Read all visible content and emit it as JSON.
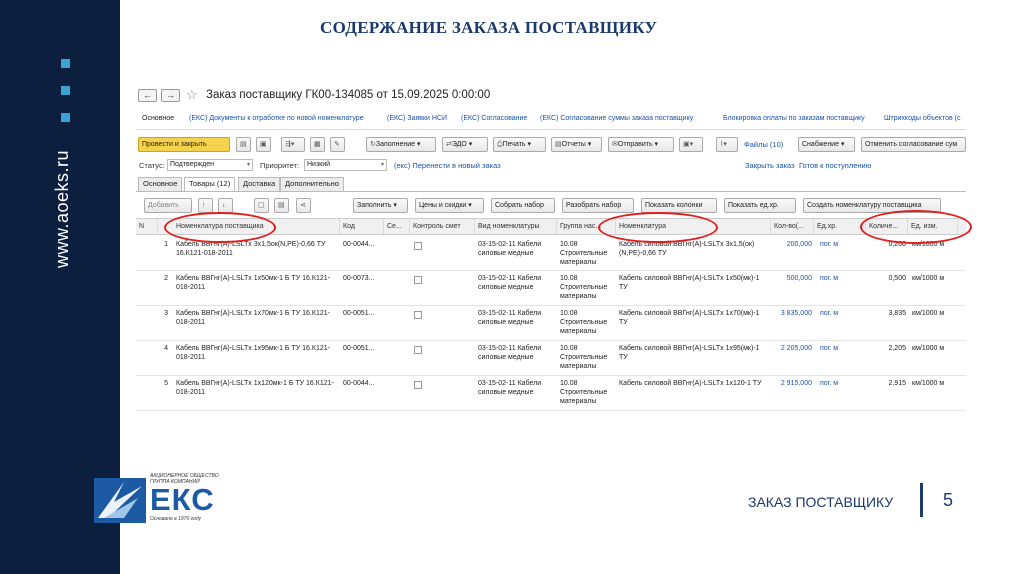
{
  "slide": {
    "title": "СОДЕРЖАНИЕ ЗАКАЗА ПОСТАВЩИКУ",
    "website": "www.aoeks.ru",
    "footer_text": "ЗАКАЗ ПОСТАВЩИКУ",
    "page_number": "5",
    "logo": {
      "top_text": "Акционерное общество\nГРУППА КОМПАНИЙ",
      "name": "ЕКС",
      "sub_text": "Основано в 1970 году"
    },
    "colors": {
      "sidebar": "#0d1f3f",
      "accent": "#3aa3d8",
      "title": "#1b3a6b",
      "highlight": "#e02020"
    }
  },
  "window": {
    "back_icon": "arrow-left-icon",
    "forward_icon": "arrow-right-icon",
    "favorite_icon": "star-icon",
    "document_title": "Заказ поставщику ГК00-134085 от 15.09.2025 0:00:00",
    "nav_links": [
      "Основное",
      "(ЕКС) Документы к отработке по новой номенклатуре",
      "(ЕКС) Заявки НСИ",
      "(ЕКС) Согласование",
      "(ЕКС) Согласование суммы заказа поставщику",
      "Блокировка оплаты по заказам поставщику",
      "Штрихкоды объектов (с"
    ],
    "toolbar": {
      "post_close": "Провести и закрыть",
      "fill": "Заполнение",
      "edo": "ЭДО",
      "print": "Печать",
      "reports": "Отчеты",
      "send": "Отправить",
      "files": "Файлы (10)",
      "supply": "Снабжение",
      "cancel_approval": "Отменить согласование сум"
    },
    "fields": {
      "status_label": "Статус:",
      "status_value": "Подтвержден",
      "priority_label": "Приоритет:",
      "priority_value": "Низкий",
      "move_link": "(екс) Перенести в новый заказ",
      "close_order": "Закрыть заказ",
      "ready": "Готов к поступлению"
    },
    "tabs": [
      "Основное",
      "Товары (12)",
      "Доставка",
      "Дополнительно"
    ],
    "grid_toolbar": {
      "add": "Добавить",
      "fill": "Заполнить",
      "prices": "Цены и скидки",
      "collect_set": "Собрать набор",
      "split_set": "Разобрать набор",
      "show_columns": "Показать колонки",
      "show_units": "Показать ед.хр.",
      "create_nomenclature": "Создать номенклатуру поставщика"
    },
    "columns": [
      "N",
      "Номенклатура поставщика",
      "Код",
      "Се...",
      "Контроль смет",
      "Вид номенклатуры",
      "Группа нас...",
      "Номенклатура",
      "Кол-во(...",
      "Ед.хр.",
      "Количе...",
      "Ед. изм."
    ],
    "rows": [
      {
        "n": "1",
        "supplier_item": "Кабель ВВГнг(A)-LSLTx 3х1,5ок(N,PE)-0,66 ТУ 16.К121-018-2011",
        "code": "00-0044...",
        "kind": "03-15-02-11 Кабели силовые медные",
        "group": "10.08 Строительные материалы",
        "item": "Кабель силовой ВВГнг(A)-LSLTx 3х1,5(ок)(N,PE)-0,66 ТУ",
        "qty_store": "200,000",
        "unit_store": "пог. м",
        "qty": "0,200",
        "unit": "км/1000 м"
      },
      {
        "n": "2",
        "supplier_item": "Кабель ВВГнг(A)-LSLTx 1х50мк-1 Б ТУ 16.К121-018-2011",
        "code": "00-0073...",
        "kind": "03-15-02-11 Кабели силовые медные",
        "group": "10.08 Строительные материалы",
        "item": "Кабель силовой ВВГнг(A)-LSLTx 1х50(мк)-1 ТУ",
        "qty_store": "500,000",
        "unit_store": "пог. м",
        "qty": "0,500",
        "unit": "км/1000 м"
      },
      {
        "n": "3",
        "supplier_item": "Кабель ВВГнг(A)-LSLTx 1х70мк-1 Б ТУ 16.К121-018-2011",
        "code": "00-0051...",
        "kind": "03-15-02-11 Кабели силовые медные",
        "group": "10.08 Строительные материалы",
        "item": "Кабель силовой ВВГнг(A)-LSLTx 1х70(мк)-1 ТУ",
        "qty_store": "3 835,000",
        "unit_store": "пог. м",
        "qty": "3,835",
        "unit": "км/1000 м"
      },
      {
        "n": "4",
        "supplier_item": "Кабель ВВГнг(A)-LSLTx 1х95мк-1 Б ТУ 16.К121-018-2011",
        "code": "00-0051...",
        "kind": "03-15-02-11 Кабели силовые медные",
        "group": "10.08 Строительные материалы",
        "item": "Кабель силовой ВВГнг(A)-LSLTx 1х95(мк)-1 ТУ",
        "qty_store": "2 205,000",
        "unit_store": "пог. м",
        "qty": "2,205",
        "unit": "км/1000 м"
      },
      {
        "n": "5",
        "supplier_item": "Кабель ВВГнг(A)-LSLTx 1х120мк-1 Б ТУ 16.К121-018-2011",
        "code": "00-0044...",
        "kind": "03-15-02-11 Кабели силовые медные",
        "group": "10.08 Строительные материалы",
        "item": "Кабель силовой ВВГнг(A)-LSLTx 1х120-1 ТУ",
        "qty_store": "2 915,000",
        "unit_store": "пог. м",
        "qty": "2,915",
        "unit": "км/1000 м"
      }
    ]
  }
}
